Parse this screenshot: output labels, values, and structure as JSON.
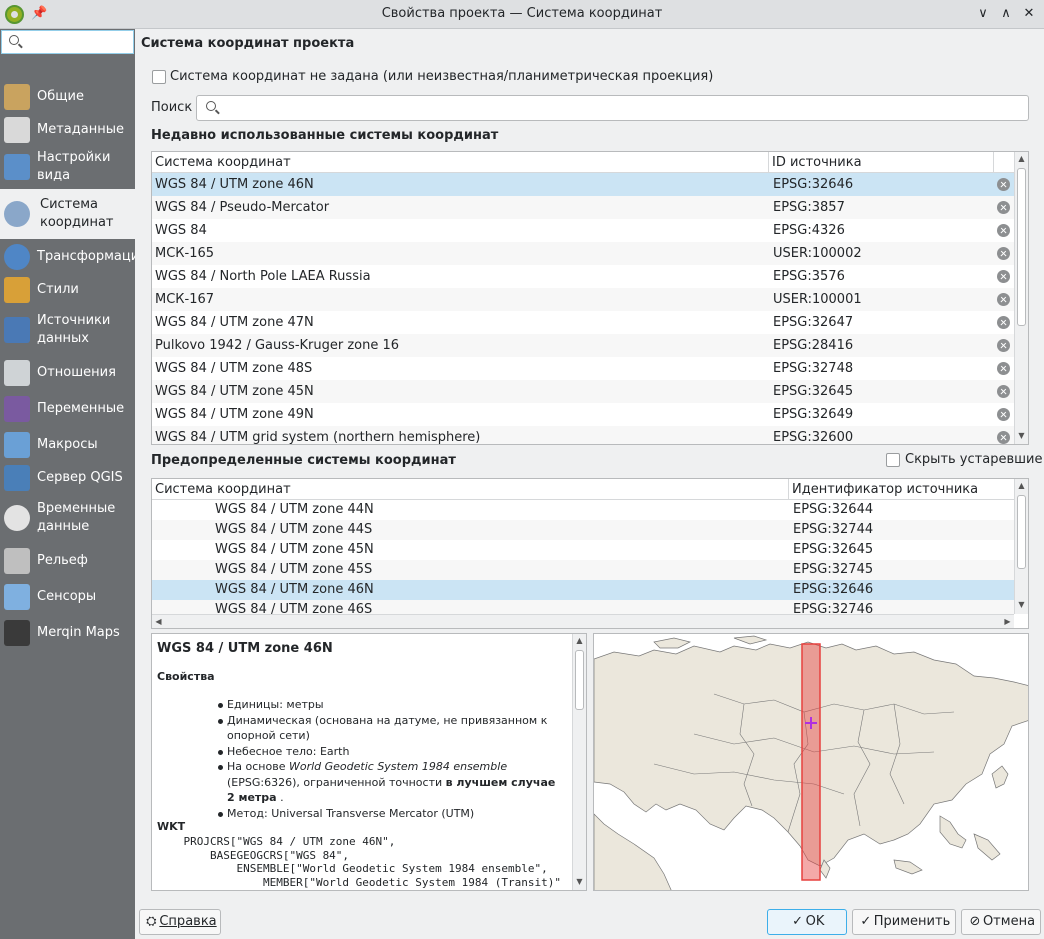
{
  "window": {
    "title": "Свойства проекта — Система координат",
    "minimize_glyph": "∨",
    "maximize_glyph": "∧",
    "close_glyph": "✕"
  },
  "sidebar": {
    "search_placeholder": "",
    "items": [
      {
        "label": "Общие",
        "icon": "tools-icon"
      },
      {
        "label": "Метаданные",
        "icon": "metadata-icon"
      },
      {
        "label": "Настройки\nвида",
        "icon": "view-settings-icon"
      },
      {
        "label": "Система\nкоординат",
        "icon": "globe-icon",
        "active": true
      },
      {
        "label": "Трансформации",
        "icon": "transform-globe-icon"
      },
      {
        "label": "Стили",
        "icon": "styles-brush-icon"
      },
      {
        "label": "Источники\nданных",
        "icon": "data-sources-icon"
      },
      {
        "label": "Отношения",
        "icon": "relations-icon"
      },
      {
        "label": "Переменные",
        "icon": "variables-icon"
      },
      {
        "label": "Макросы",
        "icon": "macros-icon"
      },
      {
        "label": "Сервер QGIS",
        "icon": "server-icon"
      },
      {
        "label": "Временные\nданные",
        "icon": "clock-icon"
      },
      {
        "label": "Рельеф",
        "icon": "terrain-icon"
      },
      {
        "label": "Сенсоры",
        "icon": "sensors-icon"
      },
      {
        "label": "Merqin Maps",
        "icon": "mergin-maps-icon"
      }
    ]
  },
  "main": {
    "section_title": "Система координат проекта",
    "no_crs_checkbox_label": "Система координат не задана (или неизвестная/планиметрическая проекция)",
    "search_label": "Поиск",
    "search_value": "",
    "recent": {
      "title": "Недавно использованные системы координат",
      "col_crs": "Система координат",
      "col_id": "ID источника",
      "rows": [
        {
          "name": "WGS 84 / UTM zone 46N",
          "id": "EPSG:32646",
          "selected": true
        },
        {
          "name": "WGS 84 / Pseudo-Mercator",
          "id": "EPSG:3857"
        },
        {
          "name": "WGS 84",
          "id": "EPSG:4326"
        },
        {
          "name": "МСК-165",
          "id": "USER:100002"
        },
        {
          "name": "WGS 84 / North Pole LAEA Russia",
          "id": "EPSG:3576"
        },
        {
          "name": "МСК-167",
          "id": "USER:100001"
        },
        {
          "name": "WGS 84 / UTM zone 47N",
          "id": "EPSG:32647"
        },
        {
          "name": "Pulkovo 1942 / Gauss-Kruger zone 16",
          "id": "EPSG:28416"
        },
        {
          "name": "WGS 84 / UTM zone 48S",
          "id": "EPSG:32748"
        },
        {
          "name": "WGS 84 / UTM zone 45N",
          "id": "EPSG:32645"
        },
        {
          "name": "WGS 84 / UTM zone 49N",
          "id": "EPSG:32649"
        },
        {
          "name": "WGS 84 / UTM grid system (northern hemisphere)",
          "id": "EPSG:32600"
        }
      ]
    },
    "predefined": {
      "title": "Предопределенные системы координат",
      "hide_deprecated_label": "Скрыть устаревшие",
      "col_crs": "Система координат",
      "col_id": "Идентификатор источника",
      "rows": [
        {
          "name": "WGS 84 / UTM zone 44N",
          "id": "EPSG:32644"
        },
        {
          "name": "WGS 84 / UTM zone 44S",
          "id": "EPSG:32744"
        },
        {
          "name": "WGS 84 / UTM zone 45N",
          "id": "EPSG:32645"
        },
        {
          "name": "WGS 84 / UTM zone 45S",
          "id": "EPSG:32745"
        },
        {
          "name": "WGS 84 / UTM zone 46N",
          "id": "EPSG:32646",
          "selected": true
        },
        {
          "name": "WGS 84 / UTM zone 46S",
          "id": "EPSG:32746"
        }
      ]
    },
    "details": {
      "title": "WGS 84 / UTM zone 46N",
      "props_heading": "Свойства",
      "units": "Единицы: метры",
      "dynamic": "Динамическая (основана на датуме, не привязанном к опорной сети)",
      "celestial": "Небесное тело: Earth",
      "based_prefix": "На основе ",
      "based_italic": "World Geodetic System 1984 ensemble",
      "based_mid": " (EPSG:6326), ограниченной точности ",
      "based_bold": "в лучшем случае 2 метра",
      "based_suffix": " .",
      "method": "Метод: Universal Transverse Mercator (UTM)",
      "wkt_heading": "WKT",
      "wkt_lines": [
        "    PROJCRS[\"WGS 84 / UTM zone 46N\",",
        "        BASEGEOGCRS[\"WGS 84\",",
        "            ENSEMBLE[\"World Geodetic System 1984 ensemble\",",
        "                MEMBER[\"World Geodetic System 1984 (Transit)\"",
        "    ]"
      ]
    },
    "map": {
      "land_color": "#ebe7dc",
      "extent_color": "#e7413e"
    }
  },
  "buttons": {
    "help": "Справка",
    "ok": "OK",
    "apply": "Применить",
    "cancel": "Отмена"
  }
}
